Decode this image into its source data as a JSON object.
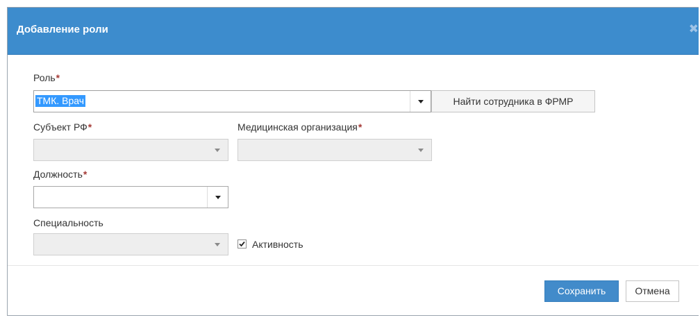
{
  "dialog": {
    "title": "Добавление роли",
    "close_icon": "close-icon"
  },
  "form": {
    "role": {
      "label": "Роль",
      "value": "ТМК. Врач",
      "required": true
    },
    "find_button_label": "Найти сотрудника в ФРМР",
    "subject": {
      "label": "Субъект РФ",
      "value": "",
      "required": true
    },
    "med_org": {
      "label": "Медицинская организация",
      "value": "",
      "required": true
    },
    "position": {
      "label": "Должность",
      "value": "",
      "required": true
    },
    "specialty": {
      "label": "Специальность",
      "value": ""
    },
    "active": {
      "label": "Активность",
      "checked": true
    },
    "required_marker": "*"
  },
  "footer": {
    "save_label": "Сохранить",
    "cancel_label": "Отмена"
  },
  "colors": {
    "header": "#3d8ccd",
    "primary": "#428bca",
    "required": "#a53b37"
  }
}
